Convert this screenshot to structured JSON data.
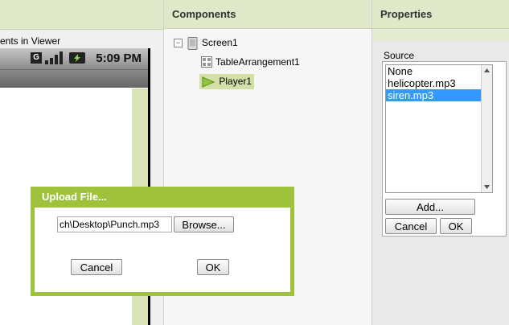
{
  "viewer": {
    "hint": "ents in Viewer",
    "time": "5:09 PM",
    "status_icons": [
      "g-network-icon",
      "signal-icon",
      "battery-icon"
    ]
  },
  "components": {
    "header": "Components",
    "tree": [
      {
        "label": "Screen1",
        "icon": "screen-icon",
        "toggle": "⊟"
      },
      {
        "label": "TableArrangement1",
        "icon": "table-arrangement-icon"
      },
      {
        "label": "Player1",
        "icon": "player-icon",
        "selected": true
      }
    ]
  },
  "properties": {
    "header": "Properties",
    "source_label": "Source",
    "options": [
      "None",
      "helicopter.mp3",
      "siren.mp3"
    ],
    "selected": "siren.mp3",
    "add_label": "Add...",
    "cancel_label": "Cancel",
    "ok_label": "OK"
  },
  "dialog": {
    "title": "Upload File...",
    "file_value": "ch\\Desktop\\Punch.mp3",
    "browse_label": "Browse...",
    "cancel_label": "Cancel",
    "ok_label": "OK"
  },
  "colors": {
    "accent": "#9ec23c",
    "header_bg": "#dfe8c9",
    "selection": "#3399ff"
  }
}
